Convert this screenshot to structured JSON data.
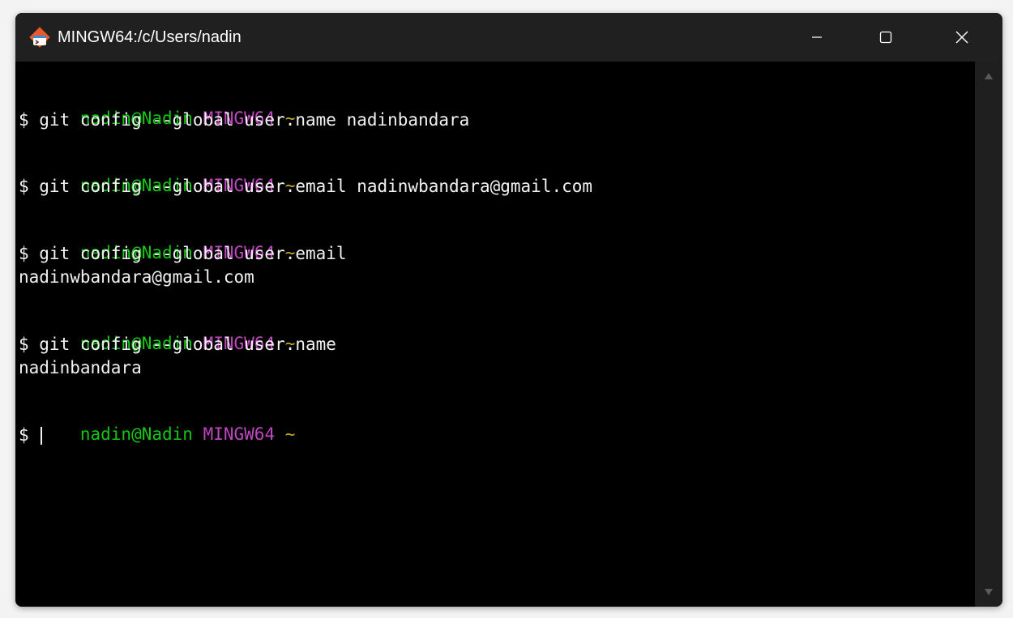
{
  "window": {
    "title": "MINGW64:/c/Users/nadin"
  },
  "prompt": {
    "user": "nadin@Nadin",
    "host": "MINGW64",
    "dir": "~",
    "symbol": "$"
  },
  "lines": [
    {
      "kind": "prompt"
    },
    {
      "kind": "cmd",
      "text": "$ git config --global user.name nadinbandara"
    },
    {
      "kind": "prompt"
    },
    {
      "kind": "cmd",
      "text": "$ git config --global user.email nadinwbandara@gmail.com"
    },
    {
      "kind": "prompt"
    },
    {
      "kind": "cmd",
      "text": "$ git config --global user.email"
    },
    {
      "kind": "out",
      "text": "nadinwbandara@gmail.com"
    },
    {
      "kind": "prompt"
    },
    {
      "kind": "cmd",
      "text": "$ git config --global user.name"
    },
    {
      "kind": "out",
      "text": "nadinbandara"
    },
    {
      "kind": "prompt"
    },
    {
      "kind": "input",
      "text": "$ "
    }
  ],
  "colors": {
    "user": "#13c713",
    "host": "#c045c0",
    "tilde": "#c9a62a",
    "text": "#f2f2f2",
    "background": "#000000",
    "titlebar": "#202020"
  },
  "icons": {
    "app": "git-bash-icon",
    "minimize": "minimize-icon",
    "maximize": "maximize-icon",
    "close": "close-icon"
  }
}
